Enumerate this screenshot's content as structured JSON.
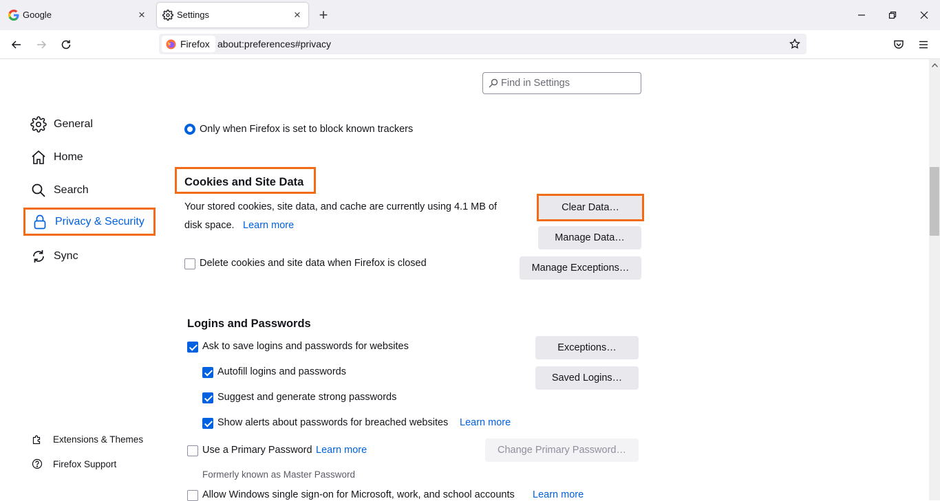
{
  "tabs": [
    {
      "title": "Google",
      "icon": "google-icon"
    },
    {
      "title": "Settings",
      "icon": "gear-icon",
      "active": true
    }
  ],
  "navbar": {
    "identity_label": "Firefox",
    "url": "about:preferences#privacy"
  },
  "search": {
    "placeholder": "Find in Settings"
  },
  "sidebar": {
    "items": [
      {
        "label": "General",
        "icon": "gear-icon"
      },
      {
        "label": "Home",
        "icon": "home-icon"
      },
      {
        "label": "Search",
        "icon": "search-icon"
      },
      {
        "label": "Privacy & Security",
        "icon": "lock-icon",
        "selected": true
      },
      {
        "label": "Sync",
        "icon": "sync-icon"
      }
    ],
    "footer": [
      {
        "label": "Extensions & Themes",
        "icon": "puzzle-icon"
      },
      {
        "label": "Firefox Support",
        "icon": "help-icon"
      }
    ]
  },
  "tracking": {
    "radio_label": "Only when Firefox is set to block known trackers"
  },
  "cookies": {
    "heading": "Cookies and Site Data",
    "desc_line1": "Your stored cookies, site data, and cache are currently using 4.1 MB of",
    "desc_line2": "disk space.",
    "learn_more": "Learn more",
    "delete_on_close": "Delete cookies and site data when Firefox is closed",
    "clear_button": "Clear Data…",
    "manage_button": "Manage Data…",
    "exceptions_button": "Manage Exceptions…"
  },
  "logins": {
    "heading": "Logins and Passwords",
    "ask_to_save": "Ask to save logins and passwords for websites",
    "autofill": "Autofill logins and passwords",
    "suggest": "Suggest and generate strong passwords",
    "alerts": "Show alerts about passwords for breached websites",
    "alerts_learn_more": "Learn more",
    "exceptions_button": "Exceptions…",
    "saved_logins_button": "Saved Logins…",
    "primary_password": "Use a Primary Password",
    "primary_learn_more": "Learn more",
    "change_primary_button": "Change Primary Password…",
    "formerly": "Formerly known as Master Password",
    "windows_sso": "Allow Windows single sign-on for Microsoft, work, and school accounts",
    "windows_sso_learn_more": "Learn more"
  },
  "colors": {
    "accent": "#0061e0",
    "highlight": "#f26b16"
  }
}
